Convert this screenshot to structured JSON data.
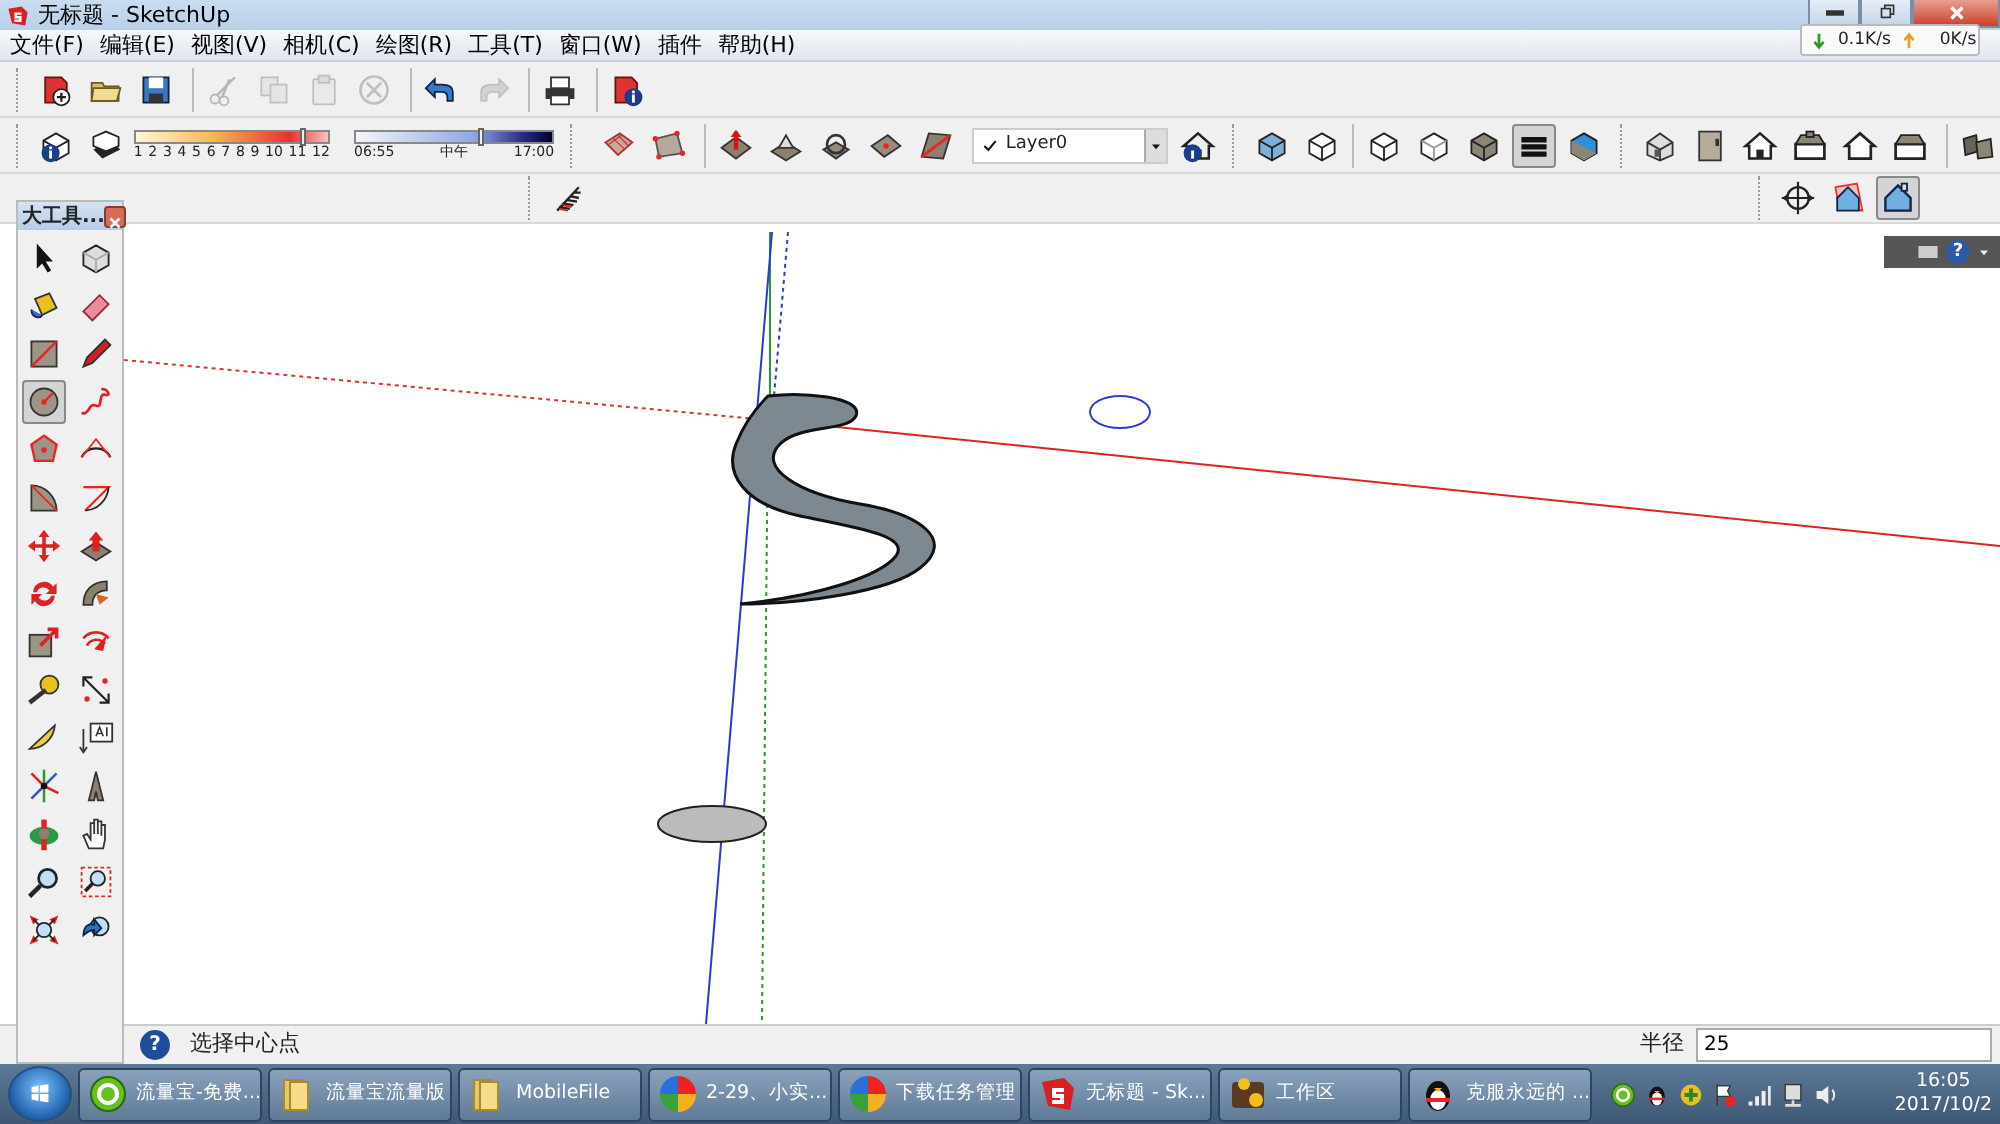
{
  "window": {
    "title": "无标题 - SketchUp"
  },
  "network_meter": {
    "download": "0.1K/s",
    "upload": "0K/s"
  },
  "menu": [
    "文件(F)",
    "编辑(E)",
    "视图(V)",
    "相机(C)",
    "绘图(R)",
    "工具(T)",
    "窗口(W)",
    "插件",
    "帮助(H)"
  ],
  "standard_toolbar": [
    {
      "disabled": false
    },
    {
      "disabled": false
    },
    {
      "disabled": false
    },
    {
      "disabled": true
    },
    {
      "disabled": true
    },
    {
      "disabled": true
    },
    {
      "disabled": true
    },
    {
      "disabled": false
    },
    {
      "disabled": true
    },
    {
      "disabled": false
    },
    {
      "disabled": false
    }
  ],
  "shadow_settings": {
    "month_slider": {
      "level": 0.87,
      "labels": [
        "1",
        "2",
        "3",
        "4",
        "5",
        "6",
        "7",
        "8",
        "9",
        "10",
        "11",
        "12"
      ]
    },
    "time_slider": {
      "level": 0.64,
      "labels": [
        "06:55",
        "中午",
        "17:00"
      ]
    }
  },
  "layer_dropdown": {
    "value": "Layer0",
    "checked": true
  },
  "style_toolbar": [
    {
      "selected": false
    },
    {
      "selected": false
    },
    {
      "selected": false
    },
    {
      "selected": true
    },
    {
      "selected": false
    }
  ],
  "camera_toolbar": [
    {
      "selected": false
    },
    {
      "selected": false
    },
    {
      "selected": true
    }
  ],
  "canvas_controls": {
    "help_glyph": "?"
  },
  "toolbox": {
    "title": "大工具...",
    "tools": [
      {
        "selected": false
      },
      {
        "selected": false
      },
      {
        "selected": false
      },
      {
        "selected": false
      },
      {
        "selected": false
      },
      {
        "selected": false
      },
      {
        "selected": true
      },
      {
        "selected": false
      },
      {
        "selected": false
      },
      {
        "selected": false
      },
      {
        "selected": false
      },
      {
        "selected": false
      },
      {
        "selected": false
      },
      {
        "selected": false
      },
      {
        "selected": false
      },
      {
        "selected": false
      },
      {
        "selected": false
      },
      {
        "selected": false
      },
      {
        "selected": false
      },
      {
        "selected": false
      },
      {
        "selected": false
      },
      {
        "selected": false
      },
      {
        "selected": false
      },
      {
        "selected": false
      },
      {
        "selected": false
      },
      {
        "selected": false
      },
      {
        "selected": false
      },
      {
        "selected": false
      },
      {
        "selected": false
      },
      {
        "selected": false
      }
    ]
  },
  "status_bar": {
    "help_glyph": "?",
    "hint": "选择中心点",
    "measure_label": "半径",
    "measure_value": "25"
  },
  "taskbar": {
    "items": [
      {
        "label": "流量宝-免费..."
      },
      {
        "label": "流量宝流量版"
      },
      {
        "label": "MobileFile"
      },
      {
        "label": "2-29、小实..."
      },
      {
        "label": "下载任务管理"
      },
      {
        "label": "无标题 - Sk..."
      },
      {
        "label": "工作区"
      },
      {
        "label": "克服永远的 ..."
      }
    ],
    "clock": {
      "time": "16:05",
      "date": "2017/10/2"
    }
  }
}
